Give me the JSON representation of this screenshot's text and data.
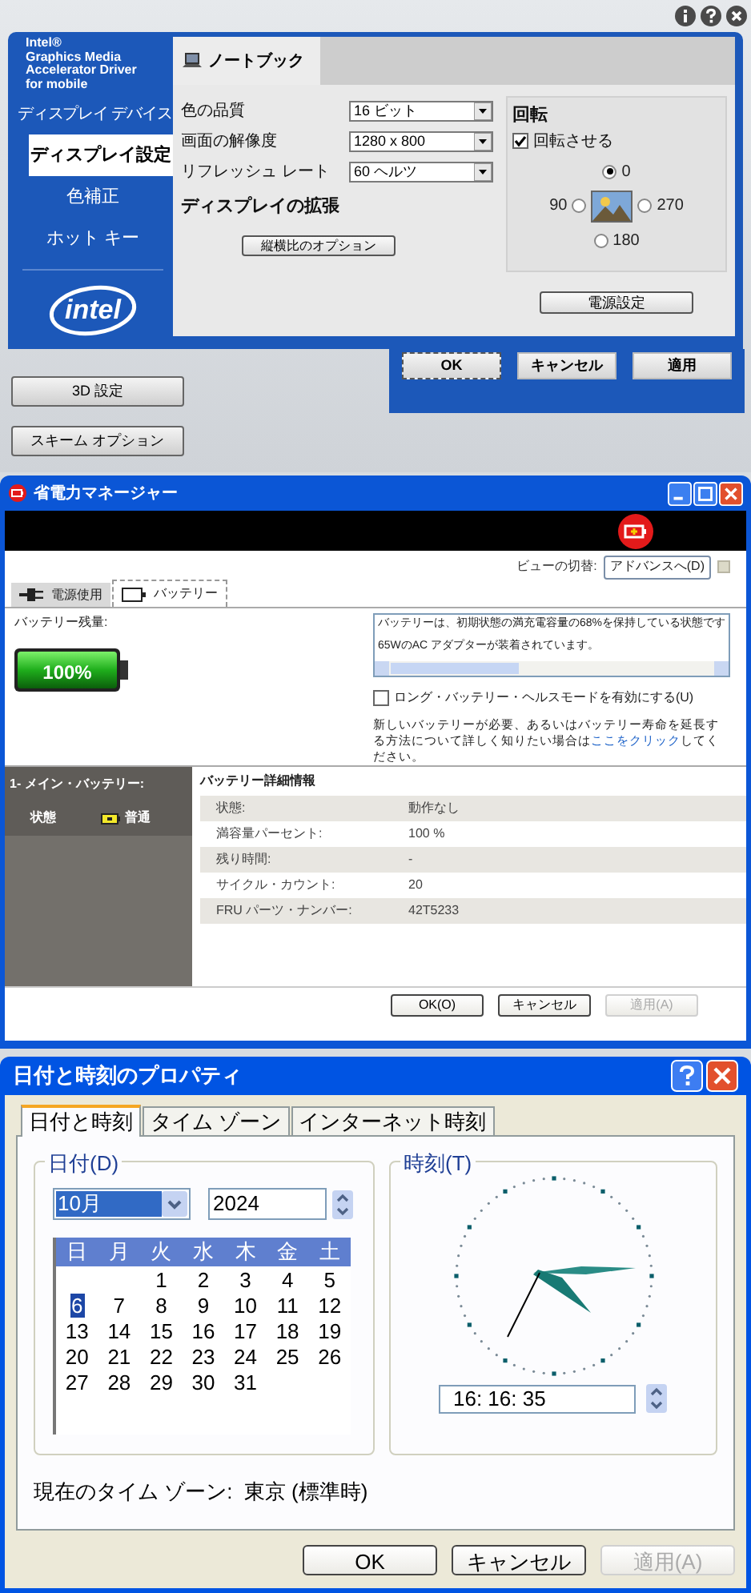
{
  "display_driver": {
    "brand_lines": [
      "Intel®",
      "Graphics Media",
      "Accelerator Driver",
      "for mobile"
    ],
    "nav": [
      {
        "label": "ディスプレイ デバイス",
        "selected": false
      },
      {
        "label": "ディスプレイ設定",
        "selected": true
      },
      {
        "label": "色補正",
        "selected": false
      },
      {
        "label": "ホット キー",
        "selected": false
      }
    ],
    "logo": "intel",
    "device_tab": "ノートブック",
    "settings": [
      {
        "label": "色の品質",
        "value": "16 ビット"
      },
      {
        "label": "画面の解像度",
        "value": "1280 x 800"
      },
      {
        "label": "リフレッシュ レート",
        "value": "60 ヘルツ"
      }
    ],
    "extension_heading": "ディスプレイの拡張",
    "aspect_button": "縦横比のオプション",
    "rotation": {
      "title": "回転",
      "enable": {
        "label": "回転させる",
        "checked": true
      },
      "options": [
        {
          "label": "0",
          "selected": true
        },
        {
          "label": "90",
          "selected": false
        },
        {
          "label": "270",
          "selected": false
        },
        {
          "label": "180",
          "selected": false
        }
      ]
    },
    "power_button": "電源設定",
    "buttons": [
      "OK",
      "キャンセル",
      "適用"
    ],
    "side_buttons": [
      "3D 設定",
      "スキーム オプション"
    ]
  },
  "power_manager": {
    "title": "省電力マネージャー",
    "view_switch_label": "ビューの切替:",
    "view_switch_button": "アドバンスへ(D)",
    "tabs": [
      {
        "label": "電源使用",
        "selected": false
      },
      {
        "label": "バッテリー",
        "selected": true
      }
    ],
    "battery_label": "バッテリー残量:",
    "battery": {
      "level": 1,
      "reading": "100%"
    },
    "messages": [
      "バッテリーは、初期状態の満充電容量の68%を保持している状態です",
      "65WのAC アダプターが装着されています。"
    ],
    "long_life_mode": {
      "label": "ロング・バッテリー・ヘルスモードを有効にする(U)",
      "checked": false
    },
    "info_text": {
      "before": "新しいバッテリーが必要、あるいはバッテリー寿命を延長する方法について詳しく知りたい場合は",
      "link": "ここをクリック",
      "after": "してください。"
    },
    "battery_list": {
      "title": "1- メイン・バッテリー:",
      "status_label": "状態",
      "status": "普通"
    },
    "details": {
      "title": "バッテリー詳細情報",
      "rows": [
        {
          "label": "状態:",
          "value": "動作なし"
        },
        {
          "label": "満容量パーセント:",
          "value": "100 %"
        },
        {
          "label": "残り時間:",
          "value": "-"
        },
        {
          "label": "サイクル・カウント:",
          "value": "20"
        },
        {
          "label": "FRU パーツ・ナンバー:",
          "value": "42T5233"
        }
      ]
    },
    "buttons": [
      {
        "label": "OK(O)",
        "disabled": false
      },
      {
        "label": "キャンセル",
        "disabled": false
      },
      {
        "label": "適用(A)",
        "disabled": true
      }
    ]
  },
  "date_time": {
    "title": "日付と時刻のプロパティ",
    "tabs": [
      {
        "label": "日付と時刻",
        "selected": true
      },
      {
        "label": "タイム ゾーン",
        "selected": false
      },
      {
        "label": "インターネット時刻",
        "selected": false
      }
    ],
    "date_group": "日付(D)",
    "month": "10月",
    "year": "2024",
    "weekdays": [
      "日",
      "月",
      "火",
      "水",
      "木",
      "金",
      "土"
    ],
    "weeks": [
      [
        {
          "day": "1",
          "selected": false
        },
        {
          "day": "2",
          "selected": false
        },
        {
          "day": "3",
          "selected": false
        },
        {
          "day": "4",
          "selected": false
        },
        {
          "day": "5",
          "selected": false
        }
      ],
      [
        {
          "day": "6",
          "selected": true
        },
        {
          "day": "7",
          "selected": false
        },
        {
          "day": "8",
          "selected": false
        },
        {
          "day": "9",
          "selected": false
        },
        {
          "day": "10",
          "selected": false
        },
        {
          "day": "11",
          "selected": false
        },
        {
          "day": "12",
          "selected": false
        }
      ],
      [
        {
          "day": "13",
          "selected": false
        },
        {
          "day": "14",
          "selected": false
        },
        {
          "day": "15",
          "selected": false
        },
        {
          "day": "16",
          "selected": false
        },
        {
          "day": "17",
          "selected": false
        },
        {
          "day": "18",
          "selected": false
        },
        {
          "day": "19",
          "selected": false
        }
      ],
      [
        {
          "day": "20",
          "selected": false
        },
        {
          "day": "21",
          "selected": false
        },
        {
          "day": "22",
          "selected": false
        },
        {
          "day": "23",
          "selected": false
        },
        {
          "day": "24",
          "selected": false
        },
        {
          "day": "25",
          "selected": false
        },
        {
          "day": "26",
          "selected": false
        }
      ],
      [
        {
          "day": "27",
          "selected": false
        },
        {
          "day": "28",
          "selected": false
        },
        {
          "day": "29",
          "selected": false
        },
        {
          "day": "30",
          "selected": false
        },
        {
          "day": "31",
          "selected": false
        }
      ]
    ],
    "time_group": "時刻(T)",
    "time": "16: 16: 35",
    "timezone": "現在のタイム ゾーン:  東京 (標準時)",
    "buttons": [
      {
        "label": "OK",
        "disabled": false
      },
      {
        "label": "キャンセル",
        "disabled": false
      },
      {
        "label": "適用(A)",
        "disabled": true
      }
    ]
  }
}
